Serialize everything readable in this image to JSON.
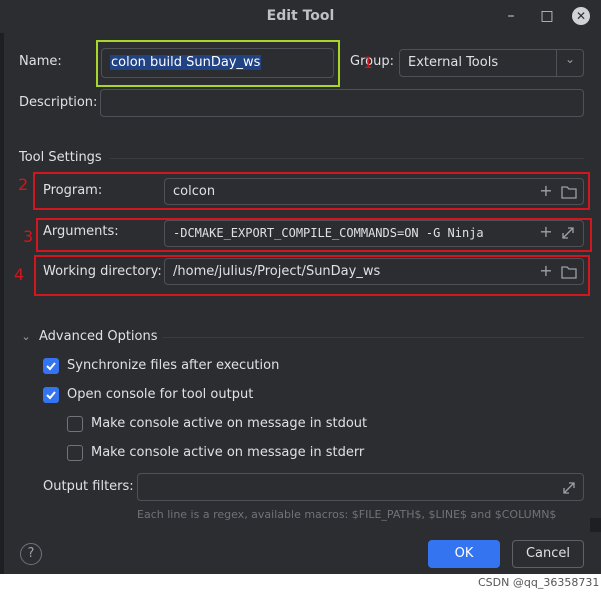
{
  "window": {
    "title": "Edit Tool",
    "minimize_icon": "minimize-icon",
    "maximize_icon": "maximize-icon",
    "close_icon": "close-icon"
  },
  "form": {
    "name_label": "Name:",
    "name_value": "colon build SunDay_ws",
    "group_label": "Group:",
    "group_value": "External Tools",
    "description_label": "Description:",
    "description_value": ""
  },
  "tool_settings": {
    "header": "Tool Settings",
    "program_label": "Program:",
    "program_value": "colcon",
    "arguments_label": "Arguments:",
    "arguments_value": "-DCMAKE_EXPORT_COMPILE_COMMANDS=ON -G Ninja",
    "workdir_label": "Working directory:",
    "workdir_value": "/home/julius/Project/SunDay_ws"
  },
  "annotations": {
    "n1": "1",
    "n2": "2",
    "n3": "3",
    "n4": "4",
    "color": "#d2161e"
  },
  "advanced": {
    "header": "Advanced Options",
    "sync_label": "Synchronize files after execution",
    "sync_checked": true,
    "console_label": "Open console for tool output",
    "console_checked": true,
    "stdout_label": "Make console active on message in stdout",
    "stdout_checked": false,
    "stderr_label": "Make console active on message in stderr",
    "stderr_checked": false,
    "filters_label": "Output filters:",
    "filters_value": "",
    "hint": "Each line is a regex, available macros: $FILE_PATH$, $LINE$ and $COLUMN$"
  },
  "buttons": {
    "ok": "OK",
    "cancel": "Cancel",
    "help": "?"
  },
  "watermark": "CSDN @qq_36358731",
  "colors": {
    "accent": "#3574f0",
    "background": "#2b2d30",
    "highlight_border": "#a8d62b"
  }
}
